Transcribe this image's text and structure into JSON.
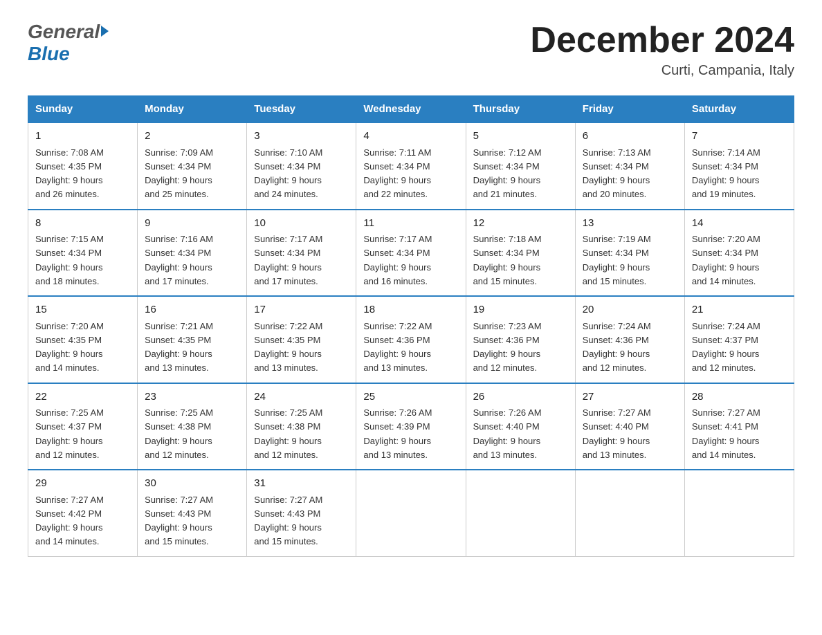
{
  "header": {
    "logo_general": "General",
    "logo_blue": "Blue",
    "month_title": "December 2024",
    "location": "Curti, Campania, Italy"
  },
  "days_of_week": [
    "Sunday",
    "Monday",
    "Tuesday",
    "Wednesday",
    "Thursday",
    "Friday",
    "Saturday"
  ],
  "weeks": [
    [
      {
        "day": "1",
        "sunrise": "7:08 AM",
        "sunset": "4:35 PM",
        "daylight": "9 hours and 26 minutes."
      },
      {
        "day": "2",
        "sunrise": "7:09 AM",
        "sunset": "4:34 PM",
        "daylight": "9 hours and 25 minutes."
      },
      {
        "day": "3",
        "sunrise": "7:10 AM",
        "sunset": "4:34 PM",
        "daylight": "9 hours and 24 minutes."
      },
      {
        "day": "4",
        "sunrise": "7:11 AM",
        "sunset": "4:34 PM",
        "daylight": "9 hours and 22 minutes."
      },
      {
        "day": "5",
        "sunrise": "7:12 AM",
        "sunset": "4:34 PM",
        "daylight": "9 hours and 21 minutes."
      },
      {
        "day": "6",
        "sunrise": "7:13 AM",
        "sunset": "4:34 PM",
        "daylight": "9 hours and 20 minutes."
      },
      {
        "day": "7",
        "sunrise": "7:14 AM",
        "sunset": "4:34 PM",
        "daylight": "9 hours and 19 minutes."
      }
    ],
    [
      {
        "day": "8",
        "sunrise": "7:15 AM",
        "sunset": "4:34 PM",
        "daylight": "9 hours and 18 minutes."
      },
      {
        "day": "9",
        "sunrise": "7:16 AM",
        "sunset": "4:34 PM",
        "daylight": "9 hours and 17 minutes."
      },
      {
        "day": "10",
        "sunrise": "7:17 AM",
        "sunset": "4:34 PM",
        "daylight": "9 hours and 17 minutes."
      },
      {
        "day": "11",
        "sunrise": "7:17 AM",
        "sunset": "4:34 PM",
        "daylight": "9 hours and 16 minutes."
      },
      {
        "day": "12",
        "sunrise": "7:18 AM",
        "sunset": "4:34 PM",
        "daylight": "9 hours and 15 minutes."
      },
      {
        "day": "13",
        "sunrise": "7:19 AM",
        "sunset": "4:34 PM",
        "daylight": "9 hours and 15 minutes."
      },
      {
        "day": "14",
        "sunrise": "7:20 AM",
        "sunset": "4:34 PM",
        "daylight": "9 hours and 14 minutes."
      }
    ],
    [
      {
        "day": "15",
        "sunrise": "7:20 AM",
        "sunset": "4:35 PM",
        "daylight": "9 hours and 14 minutes."
      },
      {
        "day": "16",
        "sunrise": "7:21 AM",
        "sunset": "4:35 PM",
        "daylight": "9 hours and 13 minutes."
      },
      {
        "day": "17",
        "sunrise": "7:22 AM",
        "sunset": "4:35 PM",
        "daylight": "9 hours and 13 minutes."
      },
      {
        "day": "18",
        "sunrise": "7:22 AM",
        "sunset": "4:36 PM",
        "daylight": "9 hours and 13 minutes."
      },
      {
        "day": "19",
        "sunrise": "7:23 AM",
        "sunset": "4:36 PM",
        "daylight": "9 hours and 12 minutes."
      },
      {
        "day": "20",
        "sunrise": "7:24 AM",
        "sunset": "4:36 PM",
        "daylight": "9 hours and 12 minutes."
      },
      {
        "day": "21",
        "sunrise": "7:24 AM",
        "sunset": "4:37 PM",
        "daylight": "9 hours and 12 minutes."
      }
    ],
    [
      {
        "day": "22",
        "sunrise": "7:25 AM",
        "sunset": "4:37 PM",
        "daylight": "9 hours and 12 minutes."
      },
      {
        "day": "23",
        "sunrise": "7:25 AM",
        "sunset": "4:38 PM",
        "daylight": "9 hours and 12 minutes."
      },
      {
        "day": "24",
        "sunrise": "7:25 AM",
        "sunset": "4:38 PM",
        "daylight": "9 hours and 12 minutes."
      },
      {
        "day": "25",
        "sunrise": "7:26 AM",
        "sunset": "4:39 PM",
        "daylight": "9 hours and 13 minutes."
      },
      {
        "day": "26",
        "sunrise": "7:26 AM",
        "sunset": "4:40 PM",
        "daylight": "9 hours and 13 minutes."
      },
      {
        "day": "27",
        "sunrise": "7:27 AM",
        "sunset": "4:40 PM",
        "daylight": "9 hours and 13 minutes."
      },
      {
        "day": "28",
        "sunrise": "7:27 AM",
        "sunset": "4:41 PM",
        "daylight": "9 hours and 14 minutes."
      }
    ],
    [
      {
        "day": "29",
        "sunrise": "7:27 AM",
        "sunset": "4:42 PM",
        "daylight": "9 hours and 14 minutes."
      },
      {
        "day": "30",
        "sunrise": "7:27 AM",
        "sunset": "4:43 PM",
        "daylight": "9 hours and 15 minutes."
      },
      {
        "day": "31",
        "sunrise": "7:27 AM",
        "sunset": "4:43 PM",
        "daylight": "9 hours and 15 minutes."
      },
      null,
      null,
      null,
      null
    ]
  ],
  "labels": {
    "sunrise": "Sunrise:",
    "sunset": "Sunset:",
    "daylight": "Daylight:"
  }
}
